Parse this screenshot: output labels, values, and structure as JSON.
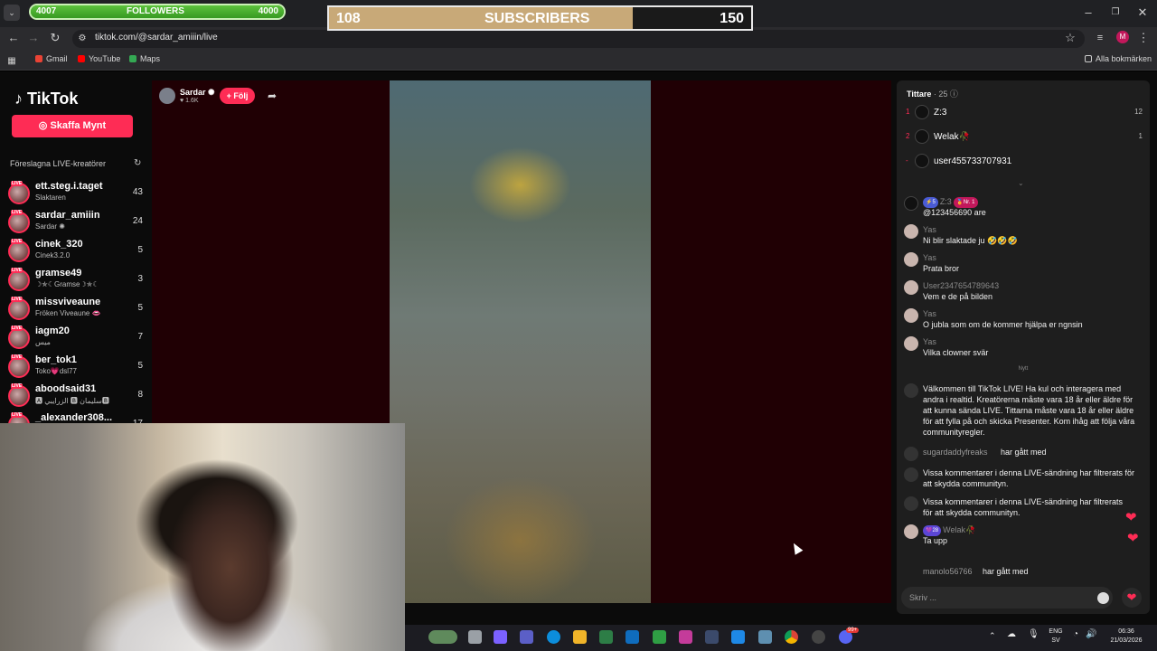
{
  "overlay": {
    "followers": {
      "current": "4007",
      "label": "FOLLOWERS",
      "goal": "4000",
      "progress": 1.0
    },
    "subscribers": {
      "current": "108",
      "label": "SUBSCRIBERS",
      "goal": "150",
      "progress": 0.72
    }
  },
  "browser": {
    "url": "tiktok.com/@sardar_amiiin/live",
    "bookmarks": [
      {
        "label": "Gmail",
        "color": "#ea4335"
      },
      {
        "label": "YouTube",
        "color": "#ff0000"
      },
      {
        "label": "Maps",
        "color": "#34a853"
      }
    ],
    "all_bookmarks": "Alla bokmärken",
    "profile_initial": "M"
  },
  "sidebar": {
    "logo": "TikTok",
    "coins_button": "Skaffa Mynt",
    "suggested_title": "Föreslagna LIVE-kreatörer",
    "live_tag": "LIVE",
    "creators": [
      {
        "name": "ett.steg.i.taget",
        "sub": "Slaktaren",
        "count": "43"
      },
      {
        "name": "sardar_amiiin",
        "sub": "Sardar ✺",
        "count": "24"
      },
      {
        "name": "cinek_320",
        "sub": "Cinek3.2.0",
        "count": "5"
      },
      {
        "name": "gramse49",
        "sub": "☽✯☾Gramse☽✯☾",
        "count": "3"
      },
      {
        "name": "missviveaune",
        "sub": "Fröken Viveaune 👄",
        "count": "5"
      },
      {
        "name": "iagm20",
        "sub": "ميس",
        "count": "7"
      },
      {
        "name": "ber_tok1",
        "sub": "Toko💗dsl77",
        "count": "5"
      },
      {
        "name": "aboodsaid31",
        "sub": "🅰 الزرايبي 🅱 سليمان🅱",
        "count": "8"
      },
      {
        "name": "_alexander308...",
        "sub": "",
        "count": "17"
      }
    ]
  },
  "stream": {
    "host_name": "Sardar ✺",
    "host_likes": "♥ 1.6K",
    "follow_button": "+ Följ"
  },
  "chat": {
    "viewers_title": "Tittare",
    "viewers_count": "· 25",
    "viewers": [
      {
        "rank": "1",
        "name": "Z:3",
        "score": "12"
      },
      {
        "rank": "2",
        "name": "Welak🥀",
        "score": "1"
      },
      {
        "rank": "-",
        "name": "user455733707931",
        "score": ""
      }
    ],
    "messages": [
      {
        "user": "Z:3",
        "badge1": "⚡5",
        "badge2": "🏅Nr. 1",
        "text": "@123456690 are"
      },
      {
        "user": "Yas",
        "text": "Ni blir slaktade ju 🤣🤣🤣"
      },
      {
        "user": "Yas",
        "text": "Prata bror"
      },
      {
        "user": "User2347654789643",
        "text": "Vem e de på bilden"
      },
      {
        "user": "Yas",
        "text": "O jubla som om de kommer hjälpa er ngnsin"
      },
      {
        "user": "Yas",
        "text": "Vilka clowner svär"
      }
    ],
    "new_separator": "Nytt",
    "welcome": "Välkommen till TikTok LIVE! Ha kul och interagera med andra i realtid. Kreatörerna måste vara 18 år eller äldre för att kunna sända LIVE. Tittarna måste vara 18 år eller äldre för att fylla på och skicka Presenter. Kom ihåg att följa våra communityregler.",
    "joined1": {
      "user": "sugardaddyfreaks",
      "tail": "har gått med"
    },
    "filtered1": "Vissa kommentarer i denna LIVE-sändning har filtrerats för att skydda communityn.",
    "filtered2": "Vissa kommentarer i denna LIVE-sändning har filtrerats för att skydda communityn.",
    "welak_msg": {
      "badge": "💜28",
      "user": "Welak🥀",
      "text": "Ta upp"
    },
    "joined2": {
      "user": "manolo56766",
      "tail": "har gått med"
    },
    "input_placeholder": "Skriv ..."
  },
  "taskbar": {
    "lang": "ENG",
    "lang_sub": "SV",
    "time": "06:36",
    "date": "21/03/2026",
    "notif_badge": "99+"
  },
  "colors": {
    "accent": "#fe2c55",
    "stage_bg": "#200004",
    "chat_bg": "#1e1e1e"
  },
  "icons": [
    "chevron-down-icon",
    "back-icon",
    "forward-icon",
    "reload-icon",
    "site-info-icon",
    "star-icon",
    "minimize-icon",
    "maximize-icon",
    "close-icon",
    "apps-icon",
    "folder-icon",
    "refresh-icon",
    "share-icon",
    "info-icon",
    "emoji-icon",
    "heart-icon"
  ]
}
